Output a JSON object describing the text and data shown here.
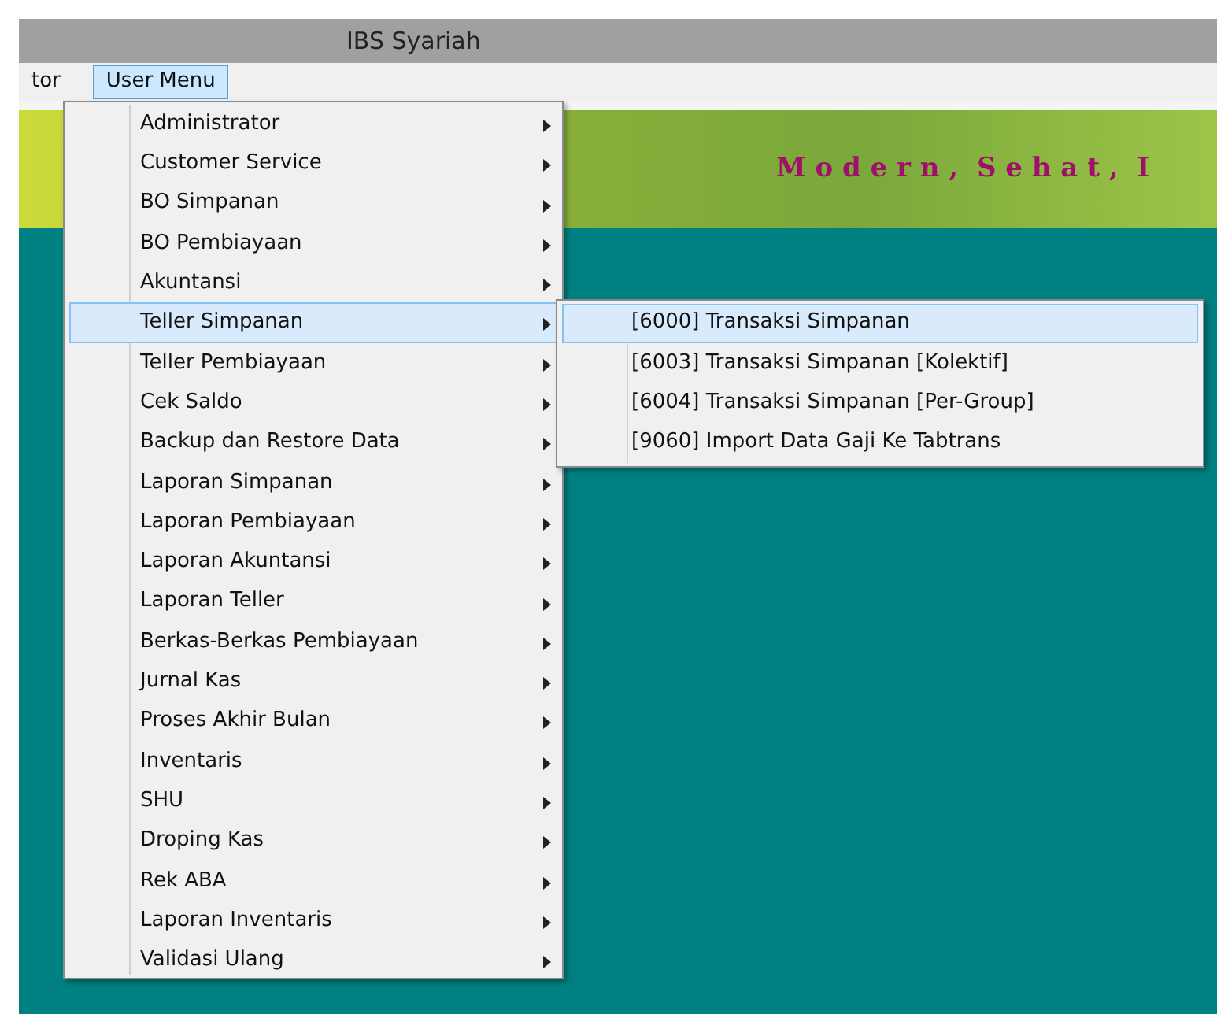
{
  "window": {
    "title": "IBS Syariah"
  },
  "menubar": [
    {
      "label": "tor",
      "selected": false
    },
    {
      "label": "User Menu",
      "selected": true
    }
  ],
  "banner": {
    "slogan": "M o d e r n ,  S e h a t ,  I"
  },
  "menu": [
    {
      "label": "Administrator",
      "selected": false
    },
    {
      "label": "Customer Service",
      "selected": false
    },
    {
      "label": "BO Simpanan",
      "selected": false
    },
    {
      "label": "BO Pembiayaan",
      "selected": false
    },
    {
      "label": "Akuntansi",
      "selected": false
    },
    {
      "label": "Teller Simpanan",
      "selected": true
    },
    {
      "label": "Teller Pembiayaan",
      "selected": false
    },
    {
      "label": "Cek Saldo",
      "selected": false
    },
    {
      "label": "Backup dan Restore Data",
      "selected": false
    },
    {
      "label": "Laporan Simpanan",
      "selected": false
    },
    {
      "label": "Laporan Pembiayaan",
      "selected": false
    },
    {
      "label": "Laporan Akuntansi",
      "selected": false
    },
    {
      "label": "Laporan Teller",
      "selected": false
    },
    {
      "label": "Berkas-Berkas Pembiayaan",
      "selected": false
    },
    {
      "label": "Jurnal Kas",
      "selected": false
    },
    {
      "label": "Proses Akhir Bulan",
      "selected": false
    },
    {
      "label": "Inventaris",
      "selected": false
    },
    {
      "label": "SHU",
      "selected": false
    },
    {
      "label": "Droping Kas",
      "selected": false
    },
    {
      "label": "Rek ABA",
      "selected": false
    },
    {
      "label": "Laporan Inventaris",
      "selected": false
    },
    {
      "label": "Validasi Ulang",
      "selected": false
    }
  ],
  "submenu": [
    {
      "label": "[6000] Transaksi Simpanan",
      "selected": true
    },
    {
      "label": "[6003] Transaksi Simpanan [Kolektif]",
      "selected": false
    },
    {
      "label": "[6004] Transaksi Simpanan [Per-Group]",
      "selected": false
    },
    {
      "label": "[9060] Import Data Gaji Ke Tabtrans",
      "selected": false
    }
  ]
}
